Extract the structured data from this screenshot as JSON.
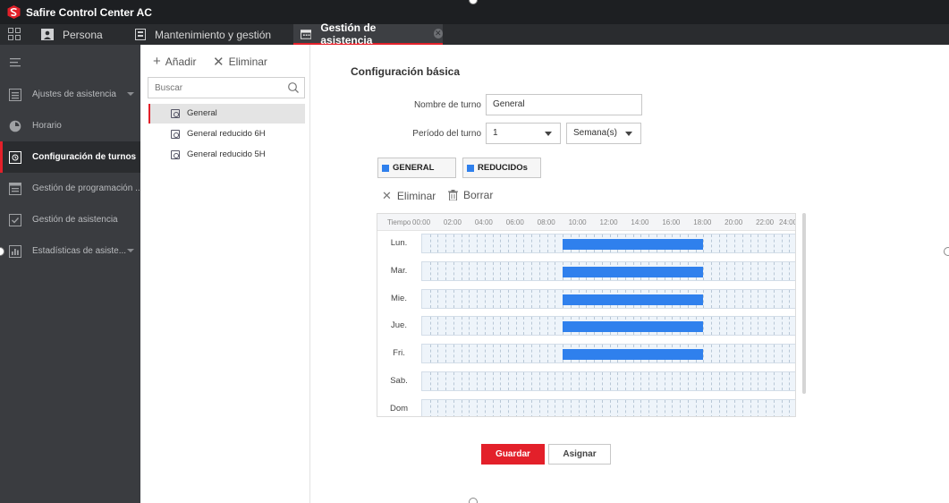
{
  "app": {
    "title": "Safire Control Center AC",
    "logo_icon": "safire-s-logo",
    "brand_color": "#e3202a"
  },
  "tabs": [
    {
      "label": "Persona",
      "icon": "person-card-icon",
      "active": false
    },
    {
      "label": "Mantenimiento y gestión",
      "icon": "maintenance-icon",
      "active": false
    },
    {
      "label": "Gestión de asistencia",
      "icon": "calendar-icon",
      "active": true,
      "close": "✕"
    }
  ],
  "sidebar": {
    "items": [
      {
        "label": "Ajustes de asistencia",
        "icon": "settings-list-icon",
        "expandable": true
      },
      {
        "label": "Horario",
        "icon": "clock-icon",
        "expandable": false
      },
      {
        "label": "Configuración de turnos",
        "icon": "shift-config-icon",
        "expandable": false,
        "active": true
      },
      {
        "label": "Gestión de programación ...",
        "icon": "schedule-icon",
        "expandable": false
      },
      {
        "label": "Gestión de asistencia",
        "icon": "attendance-check-icon",
        "expandable": false
      },
      {
        "label": "Estadísticas de asiste...",
        "icon": "statistics-icon",
        "expandable": true
      }
    ]
  },
  "shift_panel": {
    "add_label": "Añadir",
    "delete_label": "Eliminar",
    "search_placeholder": "Buscar",
    "shifts": [
      {
        "label": "General",
        "selected": true
      },
      {
        "label": "General reducido 6H",
        "selected": false
      },
      {
        "label": "General reducido 5H",
        "selected": false
      }
    ]
  },
  "config": {
    "title": "Configuración básica",
    "shift_name_label": "Nombre de turno",
    "shift_name_value": "General",
    "period_label": "Período del turno",
    "period_value": "1",
    "period_unit": "Semana(s)",
    "timetables": [
      {
        "label": "GENERAL",
        "color": "#2f80ed"
      },
      {
        "label": "REDUCIDOs",
        "color": "#2f80ed"
      }
    ],
    "delete_label": "Eliminar",
    "clear_label": "Borrar",
    "save_label": "Guardar",
    "assign_label": "Asignar"
  },
  "schedule": {
    "time_header": "Tiempo",
    "hour_labels": [
      "00:00",
      "02:00",
      "04:00",
      "06:00",
      "08:00",
      "10:00",
      "12:00",
      "14:00",
      "16:00",
      "18:00",
      "20:00",
      "22:00",
      "24:00"
    ],
    "days": [
      {
        "label": "Lun.",
        "segments": [
          [
            9,
            18
          ]
        ]
      },
      {
        "label": "Mar.",
        "segments": [
          [
            9,
            18
          ]
        ]
      },
      {
        "label": "Mie.",
        "segments": [
          [
            9,
            18
          ]
        ]
      },
      {
        "label": "Jue.",
        "segments": [
          [
            9,
            18
          ]
        ]
      },
      {
        "label": "Fri.",
        "segments": [
          [
            9,
            18
          ]
        ]
      },
      {
        "label": "Sab.",
        "segments": []
      },
      {
        "label": "Dom",
        "segments": []
      }
    ]
  }
}
